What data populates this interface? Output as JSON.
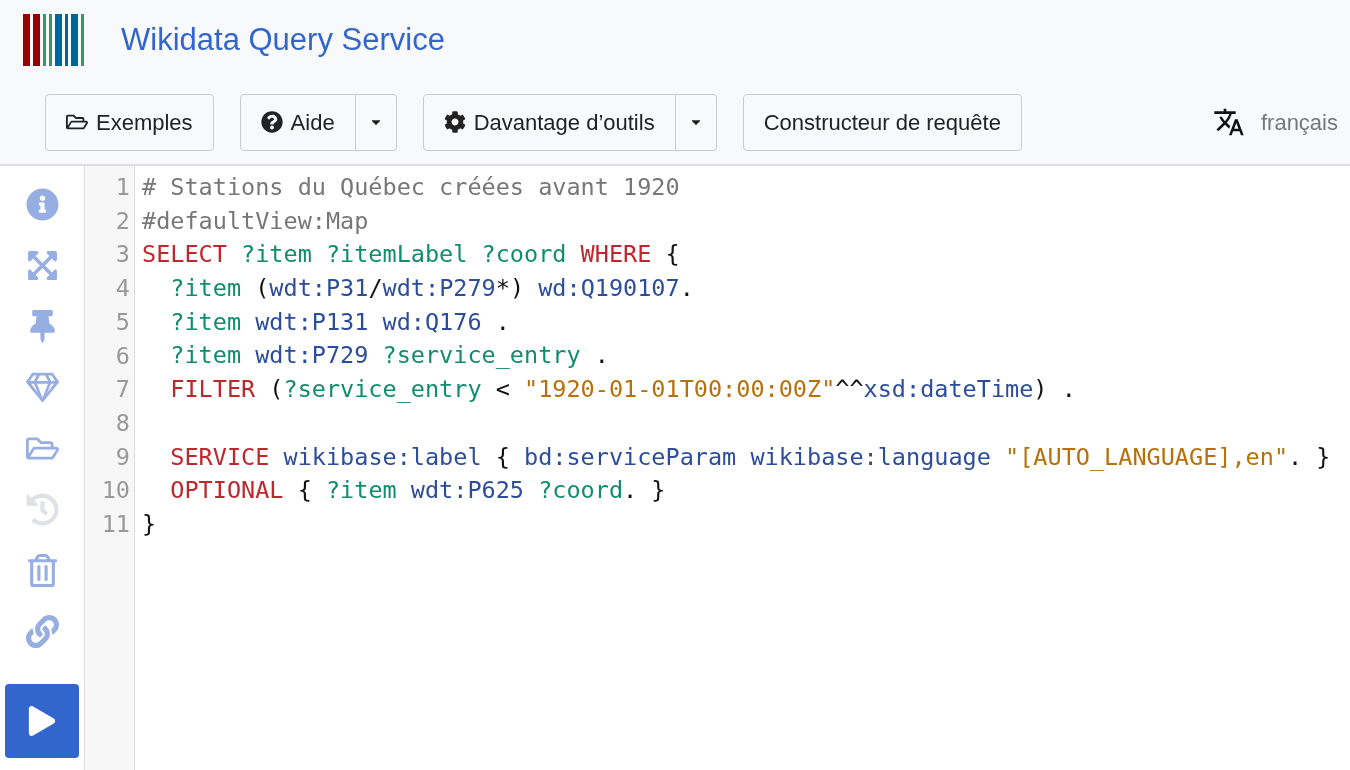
{
  "header": {
    "title": "Wikidata Query Service"
  },
  "toolbar": {
    "buttons": [
      {
        "label": "Exemples",
        "dropdown": false
      },
      {
        "label": "Aide",
        "dropdown": true
      },
      {
        "label": "Davantage d’outils",
        "dropdown": true
      },
      {
        "label": "Constructeur de requête",
        "dropdown": false
      }
    ],
    "language": "français"
  },
  "sidebar": {
    "tools": [
      {
        "disabled": false
      },
      {
        "disabled": false
      },
      {
        "disabled": false
      },
      {
        "disabled": false
      },
      {
        "disabled": false
      },
      {
        "disabled": true
      },
      {
        "disabled": false
      },
      {
        "disabled": false
      }
    ]
  },
  "editor": {
    "lines": [
      {
        "number": "1",
        "tokens": [
          {
            "kind": "comment",
            "text": "# Stations du Québec créées avant 1920"
          }
        ]
      },
      {
        "number": "2",
        "tokens": [
          {
            "kind": "comment",
            "text": "#defaultView:Map"
          }
        ]
      },
      {
        "number": "3",
        "tokens": [
          {
            "kind": "keyword",
            "text": "SELECT"
          },
          {
            "kind": "variable",
            "text": " ?item ?itemLabel ?coord "
          },
          {
            "kind": "keyword",
            "text": "WHERE"
          },
          {
            "kind": "punct",
            "text": " {"
          }
        ]
      },
      {
        "number": "4",
        "tokens": [
          {
            "kind": "variable",
            "text": "  ?item "
          },
          {
            "kind": "punct",
            "text": "("
          },
          {
            "kind": "iri",
            "text": "wdt:P31"
          },
          {
            "kind": "punct",
            "text": "/"
          },
          {
            "kind": "iri",
            "text": "wdt:P279"
          },
          {
            "kind": "punct",
            "text": "*) "
          },
          {
            "kind": "iri",
            "text": "wd:Q190107"
          },
          {
            "kind": "punct",
            "text": "."
          }
        ]
      },
      {
        "number": "5",
        "tokens": [
          {
            "kind": "variable",
            "text": "  ?item "
          },
          {
            "kind": "iri",
            "text": "wdt:P131 wd:Q176"
          },
          {
            "kind": "punct",
            "text": " ."
          }
        ]
      },
      {
        "number": "6",
        "tokens": [
          {
            "kind": "variable",
            "text": "  ?item "
          },
          {
            "kind": "iri",
            "text": "wdt:P729 "
          },
          {
            "kind": "variable",
            "text": "?service_entry"
          },
          {
            "kind": "punct",
            "text": " ."
          }
        ]
      },
      {
        "number": "7",
        "tokens": [
          {
            "kind": "keyword",
            "text": "  FILTER"
          },
          {
            "kind": "punct",
            "text": " ("
          },
          {
            "kind": "variable",
            "text": "?service_entry"
          },
          {
            "kind": "punct",
            "text": " < "
          },
          {
            "kind": "string",
            "text": "\"1920-01-01T00:00:00Z\""
          },
          {
            "kind": "punct",
            "text": "^^"
          },
          {
            "kind": "iri",
            "text": "xsd:dateTime"
          },
          {
            "kind": "punct",
            "text": ") ."
          }
        ]
      },
      {
        "number": "8"
      },
      {
        "number": "9",
        "tokens": [
          {
            "kind": "keyword",
            "text": "  SERVICE"
          },
          {
            "kind": "iri",
            "text": " wikibase:label "
          },
          {
            "kind": "punct",
            "text": "{ "
          },
          {
            "kind": "iri",
            "text": "bd:serviceParam wikibase:language "
          },
          {
            "kind": "string",
            "text": "\"[AUTO_LANGUAGE],en\""
          },
          {
            "kind": "punct",
            "text": ". }"
          }
        ]
      },
      {
        "number": "10",
        "tokens": [
          {
            "kind": "keyword",
            "text": "  OPTIONAL"
          },
          {
            "kind": "punct",
            "text": " { "
          },
          {
            "kind": "variable",
            "text": "?item "
          },
          {
            "kind": "iri",
            "text": "wdt:P625 "
          },
          {
            "kind": "variable",
            "text": "?coord"
          },
          {
            "kind": "punct",
            "text": ". }"
          }
        ]
      },
      {
        "number": "11",
        "tokens": [
          {
            "kind": "punct",
            "text": "}"
          }
        ]
      }
    ]
  }
}
